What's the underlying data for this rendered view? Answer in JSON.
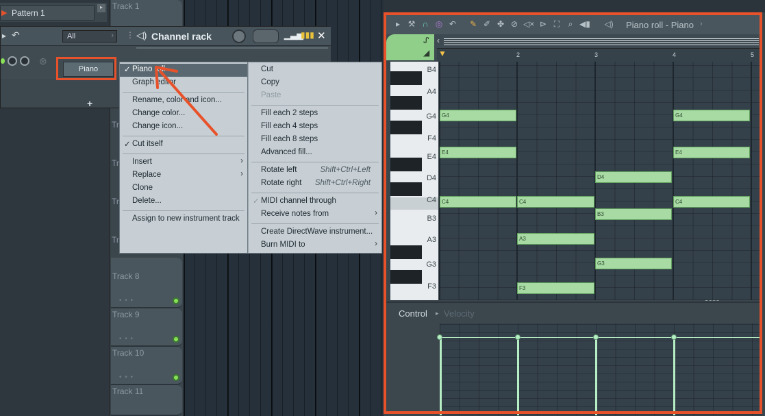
{
  "pattern": {
    "label": "Pattern 1"
  },
  "playlist": {
    "tracks": [
      "Track 1",
      "Track 8",
      "Track 9",
      "Track 10",
      "Track 11"
    ],
    "partial_tracks": [
      "Tr",
      "Tr",
      "Tr",
      "Tr",
      "Tr"
    ]
  },
  "channel_rack": {
    "title": "Channel rack",
    "filter": "All",
    "channel": "Piano",
    "add": "+"
  },
  "context_menu": {
    "left": [
      {
        "label": "Piano roll",
        "checked": true,
        "selected": true
      },
      {
        "label": "Graph editor"
      },
      {
        "label": "Rename, color and icon..."
      },
      {
        "label": "Change color..."
      },
      {
        "label": "Change icon..."
      },
      {
        "label": "Cut itself",
        "checked": true
      },
      {
        "label": "Insert",
        "submenu": true
      },
      {
        "label": "Replace",
        "submenu": true
      },
      {
        "label": "Clone"
      },
      {
        "label": "Delete..."
      },
      {
        "label": "Assign to new instrument track"
      }
    ],
    "right": [
      {
        "label": "Cut"
      },
      {
        "label": "Copy"
      },
      {
        "label": "Paste",
        "disabled": true
      },
      {
        "label": "Fill each 2 steps"
      },
      {
        "label": "Fill each 4 steps"
      },
      {
        "label": "Fill each 8 steps"
      },
      {
        "label": "Advanced fill..."
      },
      {
        "label": "Rotate left",
        "shortcut": "Shift+Ctrl+Left"
      },
      {
        "label": "Rotate right",
        "shortcut": "Shift+Ctrl+Right"
      },
      {
        "label": "MIDI channel through",
        "checked": true
      },
      {
        "label": "Receive notes from",
        "submenu": true
      },
      {
        "label": "Create DirectWave instrument..."
      },
      {
        "label": "Burn MIDI to",
        "submenu": true
      }
    ]
  },
  "piano_roll": {
    "title": "Piano roll - Piano",
    "ruler": [
      "2",
      "3",
      "4",
      "5"
    ],
    "keys": [
      "B4",
      "A4",
      "G4",
      "F4",
      "E4",
      "D4",
      "C4",
      "B3",
      "A3",
      "G3",
      "F3"
    ],
    "notes": [
      {
        "label": "G4",
        "bar": 1,
        "len": 1
      },
      {
        "label": "G4",
        "bar": 4,
        "len": 1
      },
      {
        "label": "E4",
        "bar": 1,
        "len": 1
      },
      {
        "label": "E4",
        "bar": 4,
        "len": 1
      },
      {
        "label": "D4",
        "bar": 3,
        "len": 1
      },
      {
        "label": "C4",
        "bar": 1,
        "len": 1
      },
      {
        "label": "C4",
        "bar": 2,
        "len": 1
      },
      {
        "label": "C4",
        "bar": 4,
        "len": 1
      },
      {
        "label": "B3",
        "bar": 3,
        "len": 1
      },
      {
        "label": "A3",
        "bar": 2,
        "len": 1
      },
      {
        "label": "G3",
        "bar": 3,
        "len": 1
      },
      {
        "label": "F3",
        "bar": 2,
        "len": 1
      }
    ],
    "control": {
      "label": "Control",
      "param": "Velocity"
    }
  },
  "colors": {
    "accent": "#e8522b",
    "note": "#a7dba3",
    "velocity": "#b6efc4"
  }
}
